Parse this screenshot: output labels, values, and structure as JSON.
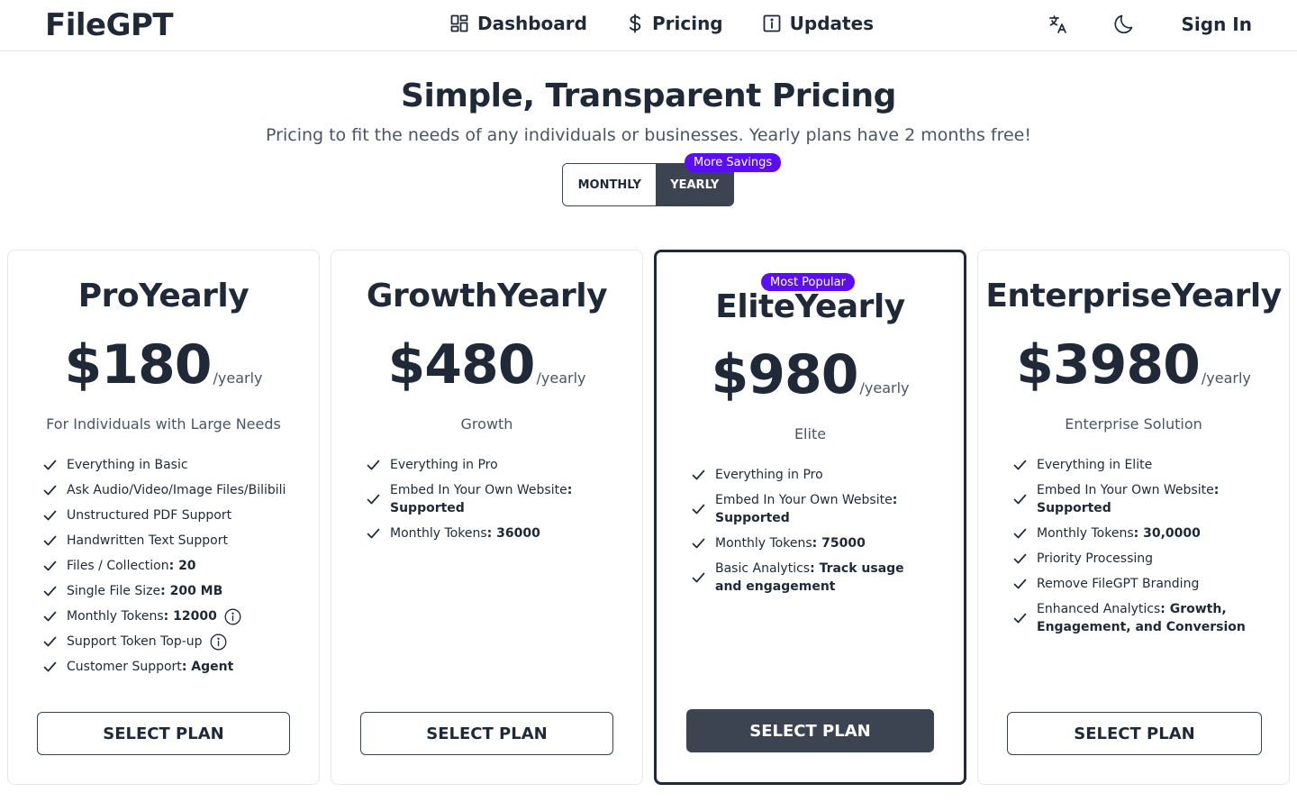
{
  "header": {
    "logo": "FileGPT",
    "nav": [
      {
        "label": "Dashboard",
        "icon": "dashboard-grid-icon"
      },
      {
        "label": "Pricing",
        "icon": "dollar-icon"
      },
      {
        "label": "Updates",
        "icon": "info-box-icon"
      }
    ],
    "translate_icon": "translate-icon",
    "theme_icon": "moon-icon",
    "sign_in": "Sign In"
  },
  "hero": {
    "title": "Simple, Transparent Pricing",
    "subtitle": "Pricing to fit the needs of any individuals or businesses. Yearly plans have 2 months free!"
  },
  "billing_toggle": {
    "monthly": "MONTHLY",
    "yearly": "YEARLY",
    "selected": "YEARLY",
    "badge": "More Savings"
  },
  "colors": {
    "accent": "#5b0ef2",
    "dark": "#3d4451",
    "text": "#1f2937"
  },
  "plans": [
    {
      "name": "ProYearly",
      "price": "$180",
      "period": "/yearly",
      "description": "For Individuals with Large Needs",
      "features": [
        {
          "text": "Everything in Basic",
          "bold": ""
        },
        {
          "text": "Ask Audio/Video/Image Files/Bilibili",
          "bold": ""
        },
        {
          "text": "Unstructured PDF Support",
          "bold": ""
        },
        {
          "text": "Handwritten Text Support",
          "bold": ""
        },
        {
          "text": "Files / Collection",
          "bold": ": 20"
        },
        {
          "text": "Single File Size",
          "bold": ": 200 MB"
        },
        {
          "text": "Monthly Tokens",
          "bold": ": 12000",
          "info": true
        },
        {
          "text": "Support Token Top-up",
          "bold": "",
          "info": true
        },
        {
          "text": "Customer Support",
          "bold": ": Agent"
        }
      ],
      "button": "SELECT PLAN"
    },
    {
      "name": "GrowthYearly",
      "price": "$480",
      "period": "/yearly",
      "description": "Growth",
      "features": [
        {
          "text": "Everything in Pro",
          "bold": ""
        },
        {
          "text": "Embed In Your Own Website",
          "bold": ": Supported"
        },
        {
          "text": "Monthly Tokens",
          "bold": ": 36000"
        }
      ],
      "button": "SELECT PLAN"
    },
    {
      "name": "EliteYearly",
      "price": "$980",
      "period": "/yearly",
      "description": "Elite",
      "badge": "Most Popular",
      "features": [
        {
          "text": "Everything in Pro",
          "bold": ""
        },
        {
          "text": "Embed In Your Own Website",
          "bold": ": Supported"
        },
        {
          "text": "Monthly Tokens",
          "bold": ": 75000"
        },
        {
          "text": "Basic Analytics",
          "bold": ": Track usage and engagement"
        }
      ],
      "button": "SELECT PLAN"
    },
    {
      "name": "EnterpriseYearly",
      "price": "$3980",
      "period": "/yearly",
      "description": "Enterprise Solution",
      "features": [
        {
          "text": "Everything in Elite",
          "bold": ""
        },
        {
          "text": "Embed In Your Own Website",
          "bold": ": Supported"
        },
        {
          "text": "Monthly Tokens",
          "bold": ": 30,0000"
        },
        {
          "text": "Priority Processing",
          "bold": ""
        },
        {
          "text": "Remove FileGPT Branding",
          "bold": ""
        },
        {
          "text": "Enhanced Analytics",
          "bold": ": Growth, Engagement, and Conversion"
        }
      ],
      "button": "SELECT PLAN"
    }
  ]
}
